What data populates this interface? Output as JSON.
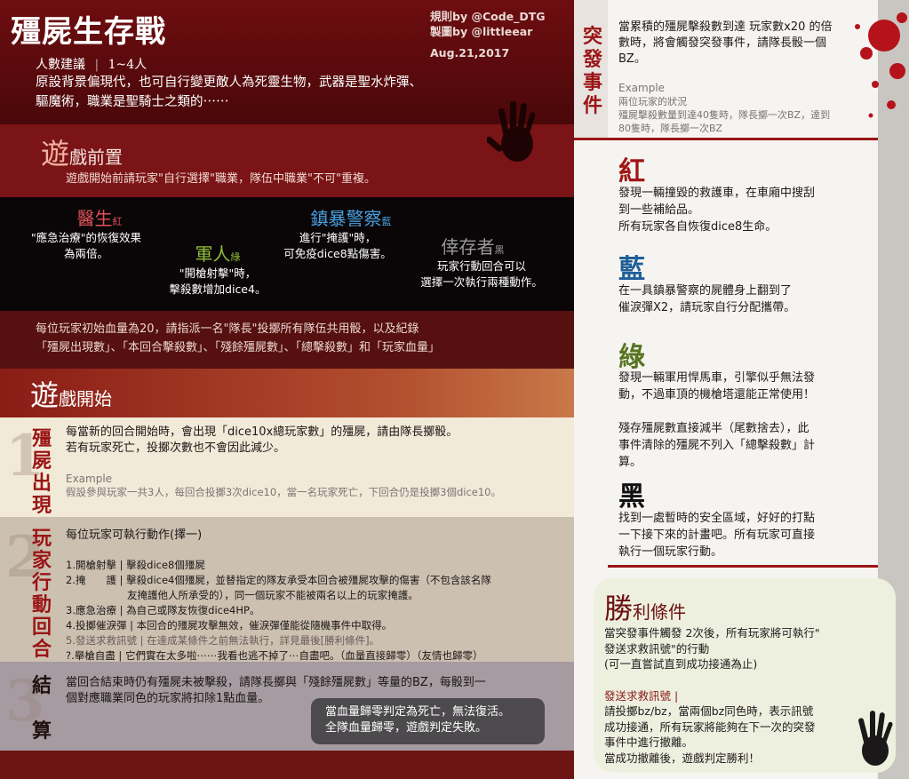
{
  "header": {
    "title": "殭屍生存戰",
    "rules_by": "規則by @Code_DTG",
    "art_by": "製圖by @littleear",
    "date": "Aug.21,2017",
    "players_label": "人數建議",
    "players_value": "1~4人",
    "intro_line1": "原設背景偏現代，也可自行變更敵人為死靈生物，武器是聖水炸彈、",
    "intro_line2": "驅魔術，職業是聖騎士之類的⋯⋯"
  },
  "setup": {
    "title_first": "遊",
    "title_rest": "戲前置",
    "desc": "遊戲開始前請玩家\"自行選擇\"職業，隊伍中職業\"不可\"重複。"
  },
  "classes": [
    {
      "name": "醫生",
      "tag": "紅",
      "color": "#e0505a",
      "desc1": "\"應急治療\"的恢復效果",
      "desc2": "為兩倍。"
    },
    {
      "name": "軍人",
      "tag": "綠",
      "color": "#8fbf3a",
      "desc1": "\"開槍射擊\"時，",
      "desc2": "擊殺數增加dice4。"
    },
    {
      "name": "鎮暴警察",
      "tag": "藍",
      "color": "#4aa0e0",
      "desc1": "進行\"掩護\"時，",
      "desc2": "可免疫dice8點傷害。"
    },
    {
      "name": "倖存者",
      "tag": "黑",
      "color": "#9a9a9a",
      "desc1": "玩家行動回合可以",
      "desc2": "選擇一次執行兩種動作。"
    }
  ],
  "hp": {
    "line1": "每位玩家初始血量為20，請指派一名\"隊長\"投擲所有隊伍共用骰，以及紀錄",
    "line2": "「殭屍出現數」、「本回合擊殺數」、「殘餘殭屍數」、「總擊殺數」和「玩家血量」"
  },
  "start": {
    "title_first": "遊",
    "title_rest": "戲開始"
  },
  "step1": {
    "number": "1",
    "label": [
      "殭",
      "屍",
      "出",
      "現"
    ],
    "line1": "每當新的回合開始時，會出現「dice10x總玩家數」的殭屍，請由隊長擲骰。",
    "line2": "若有玩家死亡，投擲次數也不會因此減少。",
    "example_label": "Example",
    "example_text": "假設參與玩家一共3人，每回合投擲3次dice10，當一名玩家死亡，下回合仍是投擲3個dice10。"
  },
  "step2": {
    "number": "2",
    "label": [
      "玩",
      "家",
      "行",
      "動",
      "回",
      "合"
    ],
    "title": "每位玩家可執行動作(擇一)",
    "actions": [
      "1.開槍射擊 | 擊殺dice8個殭屍",
      "2.掩　　護 | 擊殺dice4個殭屍，並替指定的隊友承受本回合被殭屍攻擊的傷害（不包含該名隊",
      "　　　　　　友掩護他人所承受的），同一個玩家不能被兩名以上的玩家掩護。",
      "3.應急治療 | 為自己或隊友恢復dice4HP。",
      "4.投擲催淚彈 | 本回合的殭屍攻擊無效，催淚彈僅能從隨機事件中取得。",
      "5.發送求救訊號 | 在達成某條件之前無法執行，詳見最後[勝利條件]。",
      "?.舉槍自盡 | 它們實在太多啦⋯⋯我看也逃不掉了⋯自盡吧。（血量直接歸零）（友情也歸零）"
    ]
  },
  "step3": {
    "number": "3",
    "label": [
      "結",
      "算"
    ],
    "line1": "當回合結束時仍有殭屍未被擊殺，請隊長擲與「殘餘殭屍數」等量的BZ，每骰到一",
    "line2": "個對應職業同色的玩家將扣除1點血量。",
    "note1": "當血量歸零判定為死亡，無法復活。",
    "note2": "全隊血量歸零，遊戲判定失敗。"
  },
  "events": {
    "label": [
      "突",
      "發",
      "事",
      "件"
    ],
    "line1": "當累積的殭屍擊殺數到達 玩家數x20 的倍",
    "line2": "數時，將會觸發突發事件，請隊長骰一個",
    "line3": "BZ。",
    "example_label": "Example",
    "example1": "兩位玩家的狀況",
    "example2": "殭屍擊殺數量到達40隻時，隊長擲一次BZ，達到",
    "example3": "80隻時，隊長擲一次BZ"
  },
  "colors": [
    {
      "name": "紅",
      "color": "#a11616",
      "lines": [
        "發現一輛撞毀的救護車，在車廂中搜刮",
        "到一些補給品。",
        "所有玩家各自恢復dice8生命。"
      ]
    },
    {
      "name": "藍",
      "color": "#1f5f96",
      "lines": [
        "在一具鎮暴警察的屍體身上翻到了",
        "催淚彈X2，請玩家自行分配攜帶。"
      ]
    },
    {
      "name": "綠",
      "color": "#56741f",
      "lines": [
        "發現一輛軍用悍馬車，引擎似乎無法發",
        "動，不過車頂的機槍塔還能正常使用！",
        "",
        "殘存殭屍數直接減半（尾數捨去），此",
        "事件清除的殭屍不列入「總擊殺數」計",
        "算。"
      ]
    },
    {
      "name": "黑",
      "color": "#111111",
      "lines": [
        "找到一處暫時的安全區域，好好的打點",
        "一下接下來的計畫吧。所有玩家可直接",
        "執行一個玩家行動。"
      ]
    }
  ],
  "win": {
    "title_first": "勝",
    "title_rest": "利條件",
    "line1": "當突發事件觸發 2次後，所有玩家將可執行\"",
    "line2": "發送求救訊號\"的行動",
    "line3": "(可一直嘗試直到成功接通為止)",
    "sos_label": "發送求救訊號 |",
    "sos1": "請投擲bz/bz，當兩個bz同色時，表示訊號",
    "sos2": "成功接通，所有玩家將能夠在下一次的突發",
    "sos3": "事件中進行撤離。",
    "sos4": "當成功撤離後，遊戲判定勝利！"
  }
}
